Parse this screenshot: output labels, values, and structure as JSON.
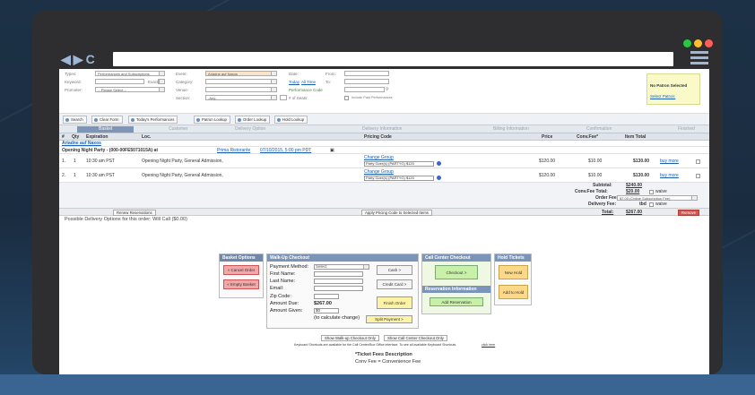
{
  "filters": {
    "types_label": "Types:",
    "types_value": "Performances and Subscriptions",
    "keyword_label": "Keyword:",
    "exact_label": "Exact",
    "promoter_label": "Promoter:",
    "promoter_value": "-- Please Select --",
    "event_label": "Event:",
    "event_value": "Ariadne auf Naxos",
    "category_label": "Category:",
    "venue_label": "Venue:",
    "section_label": "Section:",
    "section_value": "-Any-",
    "seats_label": "# of Seats:",
    "date_label": "Date:",
    "today_link": "Today",
    "alltime_link": "All Time",
    "from_label": "From:",
    "to_label": "To:",
    "perf_code_label": "Performance Code",
    "include_past_label": "Include Past Performances",
    "patron_title": "No Patron Selected",
    "patron_link": "Select Patron:"
  },
  "toolbar": {
    "search": "Search",
    "clear": "Clear Form",
    "today": "Today's Performances",
    "patron_lookup": "Patron Lookup",
    "order_lookup": "Order Lookup",
    "hold_lookup": "Hold Lookup"
  },
  "steps": {
    "basket": "Basket",
    "customer": "Customer",
    "delivery_option": "Delivery Option",
    "delivery_info": "Delivery Information",
    "billing_info": "Billing Information",
    "confirmation": "Confirmation",
    "finished": "Finished"
  },
  "columns": {
    "num": "#",
    "qty": "Qty",
    "expiration": "Expiration",
    "loc": "Loc.",
    "pricing_code": "Pricing Code",
    "price": "Price",
    "conv_fee": "Conv.Fee*",
    "item_total": "Item Total"
  },
  "event": {
    "name": "Ariadne auf Naxos",
    "line_prefix": "Opening Night Party - (000-00FE5071015A) at",
    "venue_link": "Prima Ristorante",
    "date_link": "07/10/2015, 5:00 pm PDT"
  },
  "items": [
    {
      "num": "1.",
      "qty": "1",
      "expiration": "10:30 am PST",
      "loc": "Opening Night Party, General Admission,",
      "change_group": "Change Group",
      "pricing": "Party Goer(s) (PARTYG) $120",
      "price": "$120.00",
      "fee": "$10.00",
      "total": "$130.00",
      "buy_more": "buy more"
    },
    {
      "num": "2.",
      "qty": "1",
      "expiration": "10:30 am PST",
      "loc": "Opening Night Party, General Admission,",
      "change_group": "Change Group",
      "pricing": "Party Goer(s) (PARTYG) $120",
      "price": "$120.00",
      "fee": "$10.00",
      "total": "$130.00",
      "buy_more": "buy more"
    }
  ],
  "totals": {
    "subtotal_label": "Subtotal:",
    "subtotal": "$240.00",
    "conv_fee_label": "Conv.Fee Total:",
    "conv_fee": "$20.00",
    "waive": "waive",
    "order_fee_label": "Order Fee:",
    "order_fee_value": "$7.00 (Online Subscription Fee)",
    "delivery_fee_label": "Delivery Fee:",
    "delivery_fee": "tbd",
    "total_label": "Total:",
    "total": "$267.00"
  },
  "actions": {
    "renew": "Renew Reservations",
    "apply_pricing": "Apply Pricing Code to Selected Items",
    "remove": "Remove"
  },
  "delivery_note": "Possible Delivery Options for this order: Will Call ($0.00)",
  "basket_options": {
    "title": "Basket Options",
    "cancel": "« Cancel Order",
    "empty": "« Empty Basket"
  },
  "walkup": {
    "title": "Walk-Up Checkout",
    "payment_label": "Payment Method:",
    "payment_value": "Select",
    "first_name": "First Name:",
    "last_name": "Last Name:",
    "email": "Email:",
    "zip": "Zip Code:",
    "amount_due_label": "Amount Due:",
    "amount_due": "$267.00",
    "amount_given_label": "Amount Given:",
    "amount_given_value": "$0",
    "calc_note": "(to calculate change)",
    "cash": "Cash >",
    "credit_card": "Credit Card >",
    "finish": "Finish Order",
    "split": "Split Payment >"
  },
  "call_center": {
    "title": "Call Center Checkout",
    "checkout": "Checkout >",
    "reservation_title": "Reservation Information",
    "add_reservation": "Add Reservation"
  },
  "hold": {
    "title": "Hold Tickets",
    "new_hold": "New Hold",
    "add_to_hold": "Add to Hold"
  },
  "footer": {
    "show_walkup": "Show Walk-up Checkout Only",
    "show_call_center": "Show Call Center Checkout Only",
    "shortcuts_note": "Keyboard Shortcuts are available for the Call Center/Box Office interface. To see all available Keyboard Shortcuts",
    "shortcuts_link": "click here",
    "fees_title": "*Ticket Fees Description",
    "fees_desc": "Conv Fee = Convenience Fee"
  },
  "colors": {
    "basket_header": "#7d95b6",
    "basket_options_header": "#6f87a8",
    "walkup_header": "#7a95b8",
    "call_center_header": "#7a95b8",
    "hold_header": "#7a95b8",
    "remove_button": "#d9534f",
    "cancel_button": "#f2a8a8",
    "call_center_bg": "#c8f0a8",
    "hold_bg": "#fbd88a",
    "mac_red": "#ff5f57",
    "mac_yellow": "#febc2e",
    "mac_green": "#28c840"
  }
}
